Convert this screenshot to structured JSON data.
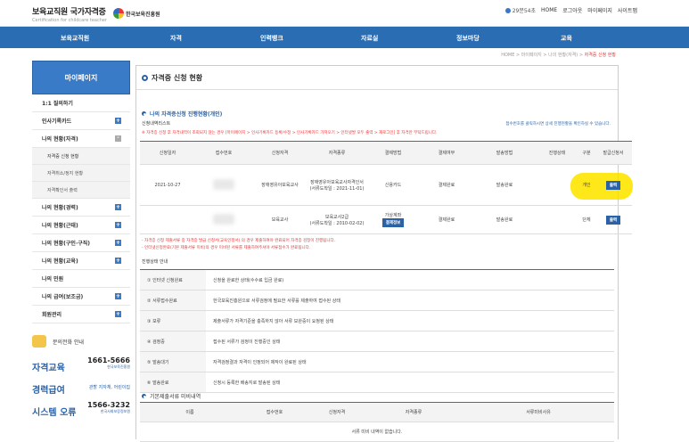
{
  "header": {
    "title": "보육교직원 국가자격증",
    "subtitle": "Certification for childcare teacher",
    "org": "한국보육진흥원",
    "time": "29분54초",
    "links": [
      "HOME",
      "로그아웃",
      "마이페이지",
      "사이트맵"
    ]
  },
  "gnb": [
    "보육교직원",
    "자격",
    "인력뱅크",
    "자료실",
    "정보마당",
    "교육"
  ],
  "breadcrumb": {
    "path": "HOME > 마이페이지 > 나의 현황(자격) > ",
    "current": "자격증 신청 현황"
  },
  "sidebar": {
    "title": "마이페이지",
    "items": [
      {
        "label": "1:1 질의하기",
        "mark": ""
      },
      {
        "label": "인사기록카드",
        "mark": "+"
      },
      {
        "label": "나의 현황(자격)",
        "mark": "-"
      },
      {
        "label": "나의 현황(경력)",
        "mark": "+"
      },
      {
        "label": "나의 현황(근태)",
        "mark": "+"
      },
      {
        "label": "나의 현황(구인·구직)",
        "mark": "+"
      },
      {
        "label": "나의 현황(교육)",
        "mark": "+"
      },
      {
        "label": "나의 민원",
        "mark": ""
      },
      {
        "label": "나의 급여(보조금)",
        "mark": "+"
      },
      {
        "label": "회원관리",
        "mark": "+"
      }
    ],
    "subitems": [
      "자격증 신청 현황",
      "자격취소/정지 현황",
      "자격확인서 출력"
    ]
  },
  "help": {
    "caption": "문의전화 안내",
    "rows": [
      {
        "k": "자격교육",
        "n": "1661-5666",
        "o": "한국보육진흥원"
      },
      {
        "k": "경력급여",
        "n": "",
        "o": "관할 지자체, 어린이집"
      },
      {
        "k": "시스템 오류",
        "n": "1566-3232",
        "o": "한국사회보장정보원"
      }
    ]
  },
  "page_title": "자격증 신청 현황",
  "section1": "나의 자격증신청 진행현황(개인)",
  "sub1": "신청내역리스트",
  "note1": "접수번호를 클릭하시면 상세 진행현황을 확인하실 수 있습니다.",
  "warn1": "※ 자격증 신청 후 자격내역이 조회되지 않는 경우 [마이페이지 > 인사기록카드 등록/수정 > 인사기록카드 가져오기 > 인터넷발 모두 출력 > 재로그인] 후 자격만 부탁드립니다.",
  "table1": {
    "headers": [
      "신청일자",
      "접수번호",
      "신청자격",
      "자격종류",
      "결제방법",
      "결제여부",
      "발송방법",
      "진행상태",
      "구분",
      "발급신청서"
    ],
    "rows": [
      {
        "date": "2021-10-27",
        "type": "장애영유아보육교사",
        "kind": "장애영유아보육교사자격인서\n(서류도착일 : 2021-11-01)",
        "pay": "신용카드",
        "status": "결제완료",
        "ship": "발송완료",
        "prog": "",
        "div": "개인",
        "btn": "출력"
      },
      {
        "date": "",
        "type": "보육교사",
        "kind": "보육교사2급\n(서류도착일 : 2010-02-02)",
        "pay": "가상계좌",
        "paybtn": "결제정보",
        "status": "결제완료",
        "ship": "발송완료",
        "prog": "",
        "div": "단체",
        "btn": "출력"
      }
    ]
  },
  "warn2": "- 자격증 신청 제출서류 중 자격증 발급 신청서(교육인정서) 의 경우 제출하여야 완료되어 자격증 검정이 진행됩니다.\n- 인터넷신청완료(기본 제출서류 미비)의 경우 미비된 서류를 제출하여주셔야 서류접수가 완료됩니다.",
  "sub2": "진행상태 안내",
  "steps": [
    {
      "k": "① 인터넷 신청완료",
      "v": "신청을 완료한 상태(수수료 입금 완료)"
    },
    {
      "k": "② 서류접수완료",
      "v": "한국보육진흥원으로 서류검정에 필요한 서류를 제출하여 접수된 상태"
    },
    {
      "k": "③ 보류",
      "v": "제출서류가 자격기준을 충족하지 않아 서류 보완중이 요청된 상태"
    },
    {
      "k": "④ 검정중",
      "v": "접수된 서류가 검정이 진행중인 상태"
    },
    {
      "k": "⑤ 발송대기",
      "v": "자격검정결과 자격이 인정되어 제작이 완료된 상태"
    },
    {
      "k": "⑥ 발송완료",
      "v": "신청시 등록한 배송지로 발송된 상태"
    }
  ],
  "section3": "기본제출서류 미비내역",
  "table3": {
    "headers": [
      "이름",
      "접수번호",
      "신청자격",
      "자격종류",
      "서류미비사유"
    ],
    "empty": "서류 미비 내역이 없습니다."
  }
}
